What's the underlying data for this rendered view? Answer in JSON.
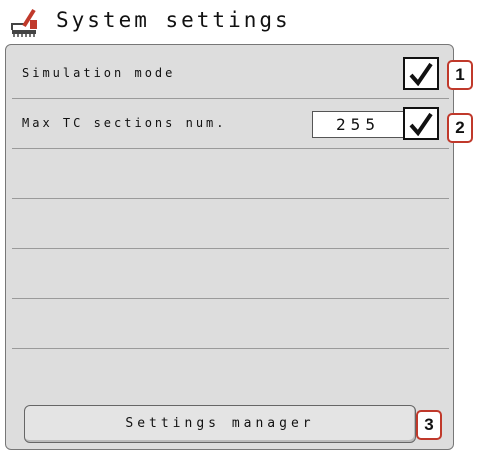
{
  "header": {
    "title": "System settings",
    "icon": "tractor-settings-icon"
  },
  "rows": [
    {
      "label": "Simulation mode",
      "checked": true
    },
    {
      "label": "Max TC sections num.",
      "value": "255",
      "checked": true
    }
  ],
  "footer": {
    "button_label": "Settings manager"
  },
  "callouts": [
    "1",
    "2",
    "3"
  ],
  "colors": {
    "panel_bg": "#dddddd",
    "callout_border": "#c0392b"
  }
}
